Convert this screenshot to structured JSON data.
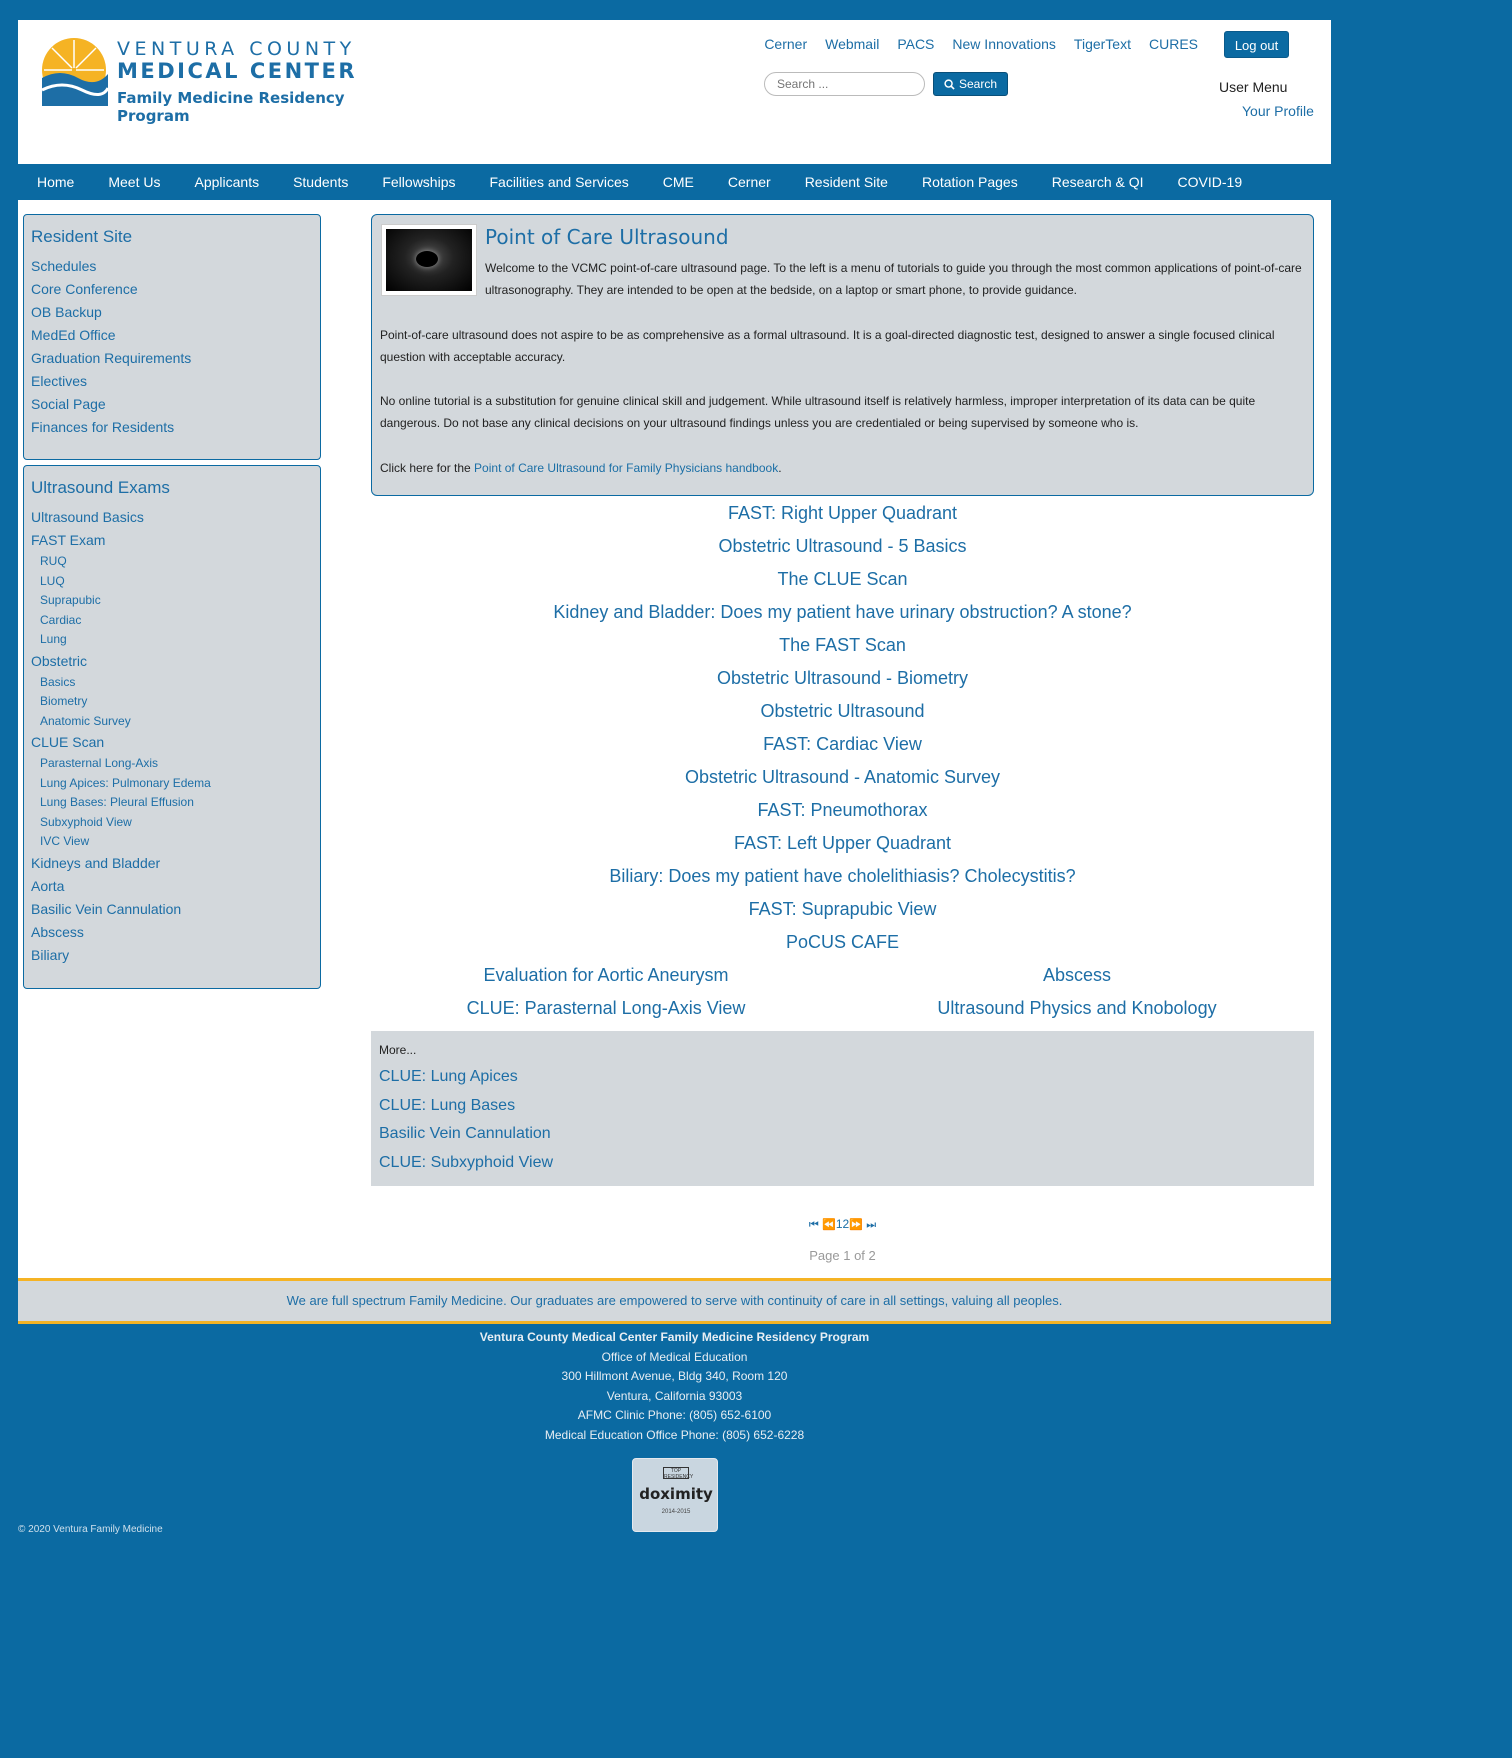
{
  "header": {
    "logo": {
      "line1": "VENTURA COUNTY",
      "line2": "MEDICAL CENTER",
      "line3": "Family Medicine Residency Program"
    },
    "top_links": [
      "Cerner",
      "Webmail",
      "PACS",
      "New Innovations",
      "TigerText",
      "CURES"
    ],
    "logout_label": "Log out",
    "search": {
      "placeholder": "Search ...",
      "button_label": "Search"
    },
    "user_menu_label": "User Menu",
    "your_profile_label": "Your Profile"
  },
  "nav": {
    "items": [
      "Home",
      "Meet Us",
      "Applicants",
      "Students",
      "Fellowships",
      "Facilities and Services",
      "CME",
      "Cerner",
      "Resident Site",
      "Rotation Pages",
      "Research & QI",
      "COVID-19"
    ]
  },
  "sidebar": {
    "resident_site": {
      "title": "Resident Site",
      "items": [
        "Schedules",
        "Core Conference",
        "OB Backup",
        "MedEd Office",
        "Graduation Requirements",
        "Electives",
        "Social Page",
        "Finances for Residents"
      ]
    },
    "ultrasound_exams": {
      "title": "Ultrasound Exams",
      "items": [
        {
          "label": "Ultrasound Basics",
          "level": 1
        },
        {
          "label": "FAST Exam",
          "level": 1
        },
        {
          "label": "RUQ",
          "level": 2
        },
        {
          "label": "LUQ",
          "level": 2
        },
        {
          "label": "Suprapubic",
          "level": 2
        },
        {
          "label": "Cardiac",
          "level": 2
        },
        {
          "label": "Lung",
          "level": 2
        },
        {
          "label": "Obstetric",
          "level": 1
        },
        {
          "label": "Basics",
          "level": 2
        },
        {
          "label": "Biometry",
          "level": 2
        },
        {
          "label": "Anatomic Survey",
          "level": 2
        },
        {
          "label": "CLUE Scan",
          "level": 1
        },
        {
          "label": "Parasternal Long-Axis",
          "level": 2
        },
        {
          "label": "Lung Apices: Pulmonary Edema",
          "level": 2
        },
        {
          "label": "Lung Bases: Pleural Effusion",
          "level": 2
        },
        {
          "label": "Subxyphoid View",
          "level": 2
        },
        {
          "label": "IVC View",
          "level": 2
        },
        {
          "label": "Kidneys and Bladder",
          "level": 1
        },
        {
          "label": "Aorta",
          "level": 1
        },
        {
          "label": "Basilic Vein Cannulation",
          "level": 1
        },
        {
          "label": "Abscess",
          "level": 1
        },
        {
          "label": "Biliary",
          "level": 1
        }
      ]
    }
  },
  "intro": {
    "title": "Point of Care Ultrasound",
    "p1": "Welcome to the VCMC point-of-care ultrasound page.  To the left is a menu of tutorials to guide you through the most common applications of point-of-care ultrasonography.  They are intended to be open at the bedside, on a laptop or smart phone, to provide guidance.",
    "p2": "Point-of-care ultrasound does not aspire to be as comprehensive as a formal ultrasound.  It is a goal-directed diagnostic test, designed to answer a single focused clinical question with acceptable accuracy.",
    "p3": "No online tutorial is a substitution for genuine clinical skill and judgement.  While ultrasound itself is relatively harmless, improper interpretation of its data can be quite dangerous.  Do not base any clinical decisions on your ultrasound findings unless you are credentialed or being supervised by someone who is.",
    "p4_prefix": "Click here for the ",
    "p4_link": "Point of Care Ultrasound for Family Physicians handbook",
    "p4_suffix": "."
  },
  "tutorials": [
    "FAST: Right Upper Quadrant",
    "Obstetric Ultrasound - 5 Basics",
    "The CLUE Scan",
    "Kidney and Bladder: Does my patient have urinary obstruction? A stone?",
    "The FAST Scan",
    "Obstetric Ultrasound - Biometry",
    "Obstetric Ultrasound",
    "FAST: Cardiac View",
    "Obstetric Ultrasound - Anatomic Survey",
    "FAST: Pneumothorax",
    "FAST: Left Upper Quadrant",
    "Biliary: Does my patient have cholelithiasis? Cholecystitis?",
    "FAST: Suprapubic View",
    "PoCUS CAFE"
  ],
  "tutorials_two_col": [
    [
      "Evaluation for Aortic Aneurysm",
      "Abscess"
    ],
    [
      "CLUE: Parasternal Long-Axis View",
      "Ultrasound Physics and Knobology"
    ]
  ],
  "more": {
    "label": "More...",
    "items": [
      "CLUE: Lung Apices",
      "CLUE: Lung Bases",
      "Basilic Vein Cannulation",
      "CLUE: Subxyphoid View"
    ]
  },
  "pager": {
    "pages": [
      "1",
      "2"
    ],
    "status": "Page 1 of 2"
  },
  "tagline": "We are full spectrum Family Medicine. Our graduates are empowered to serve with continuity of care in all settings, valuing all peoples.",
  "footer": {
    "name": "Ventura County Medical Center Family Medicine Residency Program",
    "office": "Office of Medical Education",
    "address1": "300 Hillmont Avenue, Bldg 340, Room 120",
    "address2": "Ventura, California 93003",
    "phone1": "AFMC Clinic Phone: (805) 652-6100",
    "phone2": "Medical Education Office Phone: (805) 652-6228",
    "badge": {
      "top": "TOP RESIDENCY",
      "name": "doximity",
      "years": "2014-2015"
    },
    "copyright": "© 2020 Ventura Family Medicine"
  },
  "colors": {
    "brand_blue": "#0b6aa2",
    "link_blue": "#1d6ea6",
    "panel_gray": "#d3d8dc",
    "accent_gold": "#f5b324"
  }
}
